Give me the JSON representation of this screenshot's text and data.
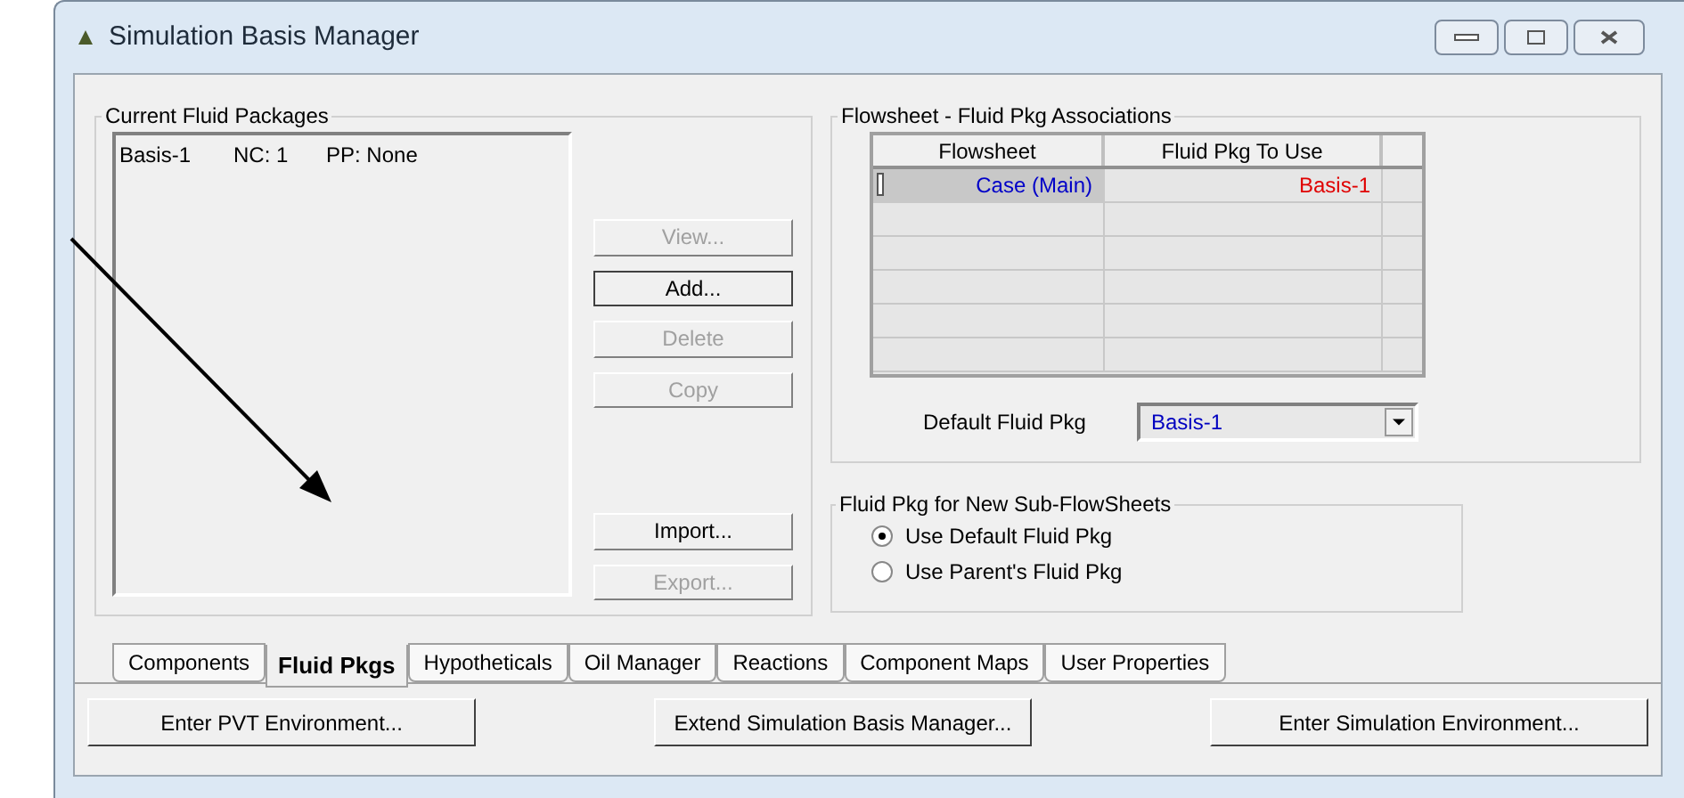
{
  "window": {
    "title": "Simulation Basis Manager"
  },
  "fluid_packages": {
    "title": "Current Fluid Packages",
    "items": [
      {
        "name": "Basis-1",
        "nc": "NC: 1",
        "pp": "PP: None"
      }
    ]
  },
  "package_buttons": [
    {
      "label": "View...",
      "disabled": true,
      "focused": false
    },
    {
      "label": "Add...",
      "disabled": false,
      "focused": true
    },
    {
      "label": "Delete",
      "disabled": true,
      "focused": false
    },
    {
      "label": "Copy",
      "disabled": true,
      "focused": false
    },
    {
      "label": "Import...",
      "disabled": false,
      "focused": false
    },
    {
      "label": "Export...",
      "disabled": true,
      "focused": false
    }
  ],
  "associations": {
    "title": "Flowsheet - Fluid Pkg Associations",
    "columns": [
      "Flowsheet",
      "Fluid Pkg To Use"
    ],
    "rows": [
      {
        "cells": [
          "Case (Main)",
          "Basis-1"
        ],
        "selected": true
      }
    ],
    "default_label": "Default Fluid Pkg",
    "default_value": "Basis-1"
  },
  "sub_flowsheets": {
    "title": "Fluid Pkg for New Sub-FlowSheets",
    "options": [
      {
        "label": "Use Default Fluid Pkg",
        "selected": true
      },
      {
        "label": "Use Parent's Fluid Pkg",
        "selected": false
      }
    ]
  },
  "tabs": [
    {
      "label": "Components",
      "selected": false
    },
    {
      "label": "Fluid Pkgs",
      "selected": true
    },
    {
      "label": "Hypotheticals",
      "selected": false
    },
    {
      "label": "Oil Manager",
      "selected": false
    },
    {
      "label": "Reactions",
      "selected": false
    },
    {
      "label": "Component Maps",
      "selected": false
    },
    {
      "label": "User Properties",
      "selected": false
    }
  ],
  "footer_buttons": [
    "Enter PVT Environment...",
    "Extend Simulation Basis Manager...",
    "Enter Simulation Environment..."
  ]
}
